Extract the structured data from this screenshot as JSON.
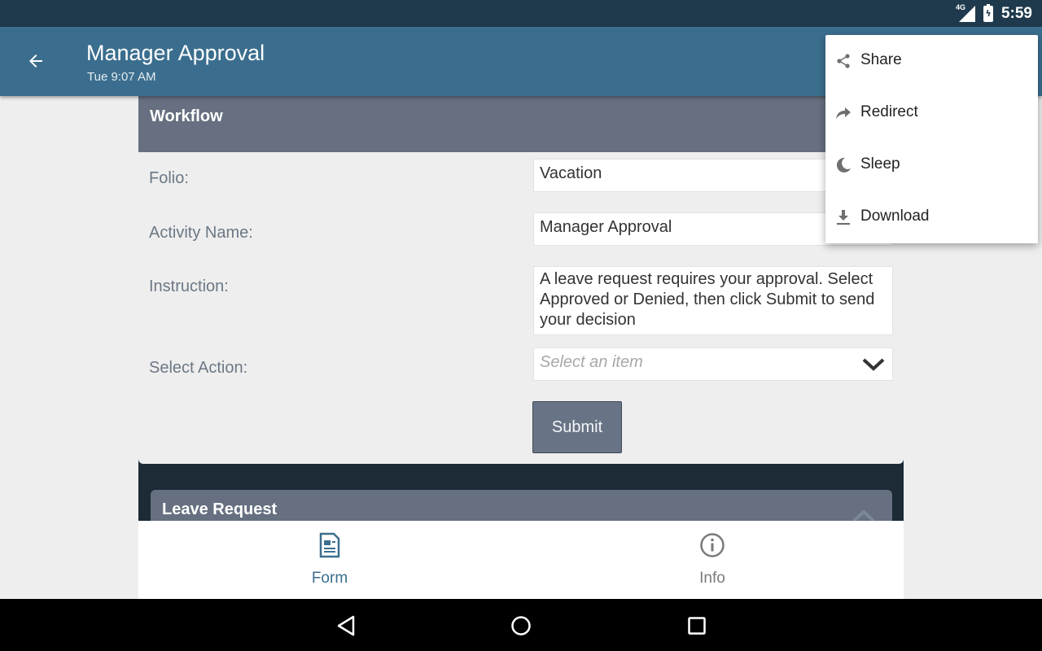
{
  "status_bar": {
    "network": "4G",
    "time": "5:59"
  },
  "toolbar": {
    "title": "Manager Approval",
    "subtitle": "Tue 9:07 AM"
  },
  "workflow": {
    "title": "Workflow",
    "folio_label": "Folio:",
    "folio_value": "Vacation",
    "activity_label": "Activity Name:",
    "activity_value": "Manager Approval",
    "instruction_label": "Instruction:",
    "instruction_value": "A leave request requires your approval. Select Approved or Denied, then click Submit to send your decision",
    "action_label": "Select Action:",
    "action_placeholder": "Select an item",
    "submit_label": "Submit"
  },
  "leave_request": {
    "title": "Leave Request"
  },
  "bottom_nav": {
    "tabs": [
      {
        "label": "Form",
        "icon": "form-icon",
        "active": true
      },
      {
        "label": "Info",
        "icon": "info-icon",
        "active": false
      }
    ]
  },
  "menu": {
    "items": [
      {
        "label": "Share",
        "icon": "share-icon"
      },
      {
        "label": "Redirect",
        "icon": "redirect-icon"
      },
      {
        "label": "Sleep",
        "icon": "moon-icon"
      },
      {
        "label": "Download",
        "icon": "download-icon"
      }
    ]
  },
  "colors": {
    "status_bar": "#1f3a4c",
    "toolbar": "#3b6e8e",
    "card_header": "#667080",
    "active_tab": "#3b6e8e"
  }
}
